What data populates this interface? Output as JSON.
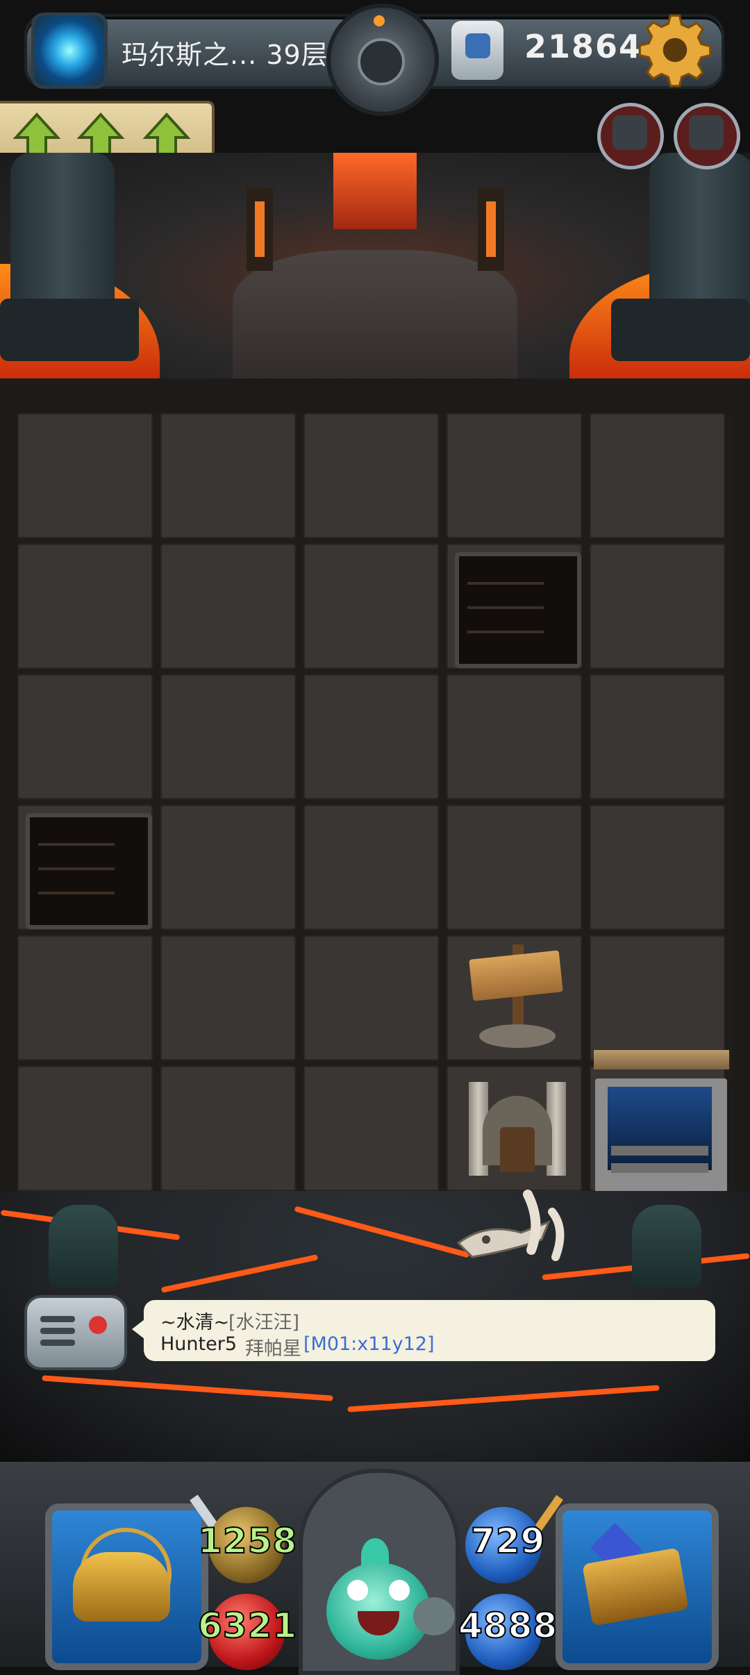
{
  "header": {
    "floor_label": "玛尔斯之... 39层",
    "gold": "21864",
    "portal_icon": "portal-icon",
    "dial_icon": "bomb-dial-icon",
    "gem_icon": "crest-gem-icon",
    "settings_icon": "gear-icon"
  },
  "buffs": {
    "up_arrows": [
      "up-arrow-icon",
      "up-arrow-icon",
      "up-arrow-icon"
    ],
    "status_icons": [
      "tower-status-icon",
      "monster-status-icon"
    ]
  },
  "board": {
    "rows": 6,
    "cols": 5,
    "tiles": [
      {
        "row": 1,
        "col": 3,
        "type": "broken-floor"
      },
      {
        "row": 3,
        "col": 0,
        "type": "broken-floor"
      },
      {
        "row": 4,
        "col": 3,
        "type": "signpost"
      },
      {
        "row": 5,
        "col": 3,
        "type": "exit-gate"
      },
      {
        "row": 5,
        "col": 4,
        "type": "stairs-down"
      }
    ]
  },
  "chat": {
    "line1_name": "~水清~",
    "line1_tag": "[水汪汪]",
    "line2_name": "Hunter5",
    "line2_text": "拜帕星",
    "line2_link": "[M01:x11y12]"
  },
  "hud": {
    "attack": "1258",
    "defense": "729",
    "hp": "6321",
    "gold": "4888",
    "left_card_icon": "equipment-helmet-icon",
    "right_card_icon": "spellbook-icon",
    "hero_icon": "hero-slime-icon"
  },
  "colors": {
    "lava": "#ff6a1a",
    "stat_blue": "#1e5fbf",
    "stat_red": "#c0161a",
    "chat_link": "#3a6fd0"
  }
}
